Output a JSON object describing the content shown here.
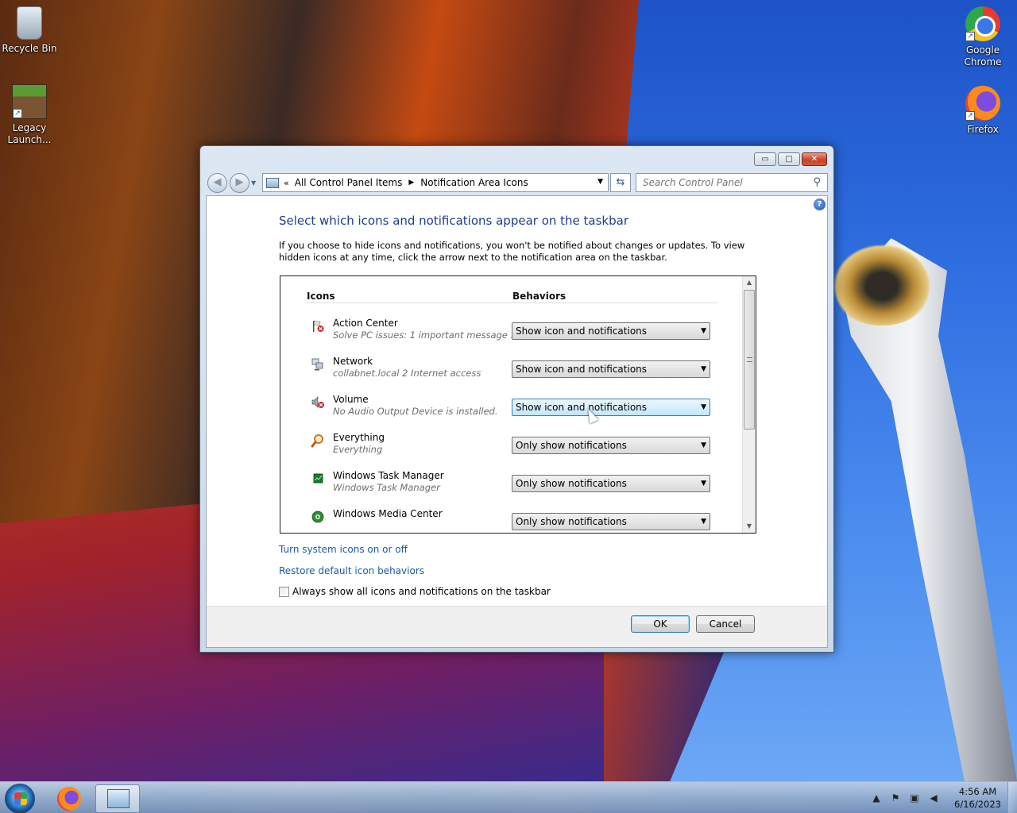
{
  "desktop": {
    "icons": [
      {
        "label": "Recycle Bin"
      },
      {
        "label": "Legacy Launch..."
      },
      {
        "label": "Google Chrome"
      },
      {
        "label": "Firefox"
      }
    ]
  },
  "window": {
    "caption": {
      "minimize": "▭",
      "maximize": "□",
      "close": "✕"
    },
    "nav": {
      "back": "◀",
      "forward": "▶"
    },
    "address": {
      "chevron": "«",
      "crumbs": [
        "All Control Panel Items",
        "Notification Area Icons"
      ]
    },
    "search": {
      "placeholder": "Search Control Panel"
    },
    "help": "?",
    "title": "Select which icons and notifications appear on the taskbar",
    "description": "If you choose to hide icons and notifications, you won't be notified about changes or updates. To view hidden icons at any time, click the arrow next to the notification area on the taskbar.",
    "table": {
      "headers": {
        "icons": "Icons",
        "behaviors": "Behaviors"
      },
      "rows": [
        {
          "name": "Action Center",
          "sub": "Solve PC issues: 1 important message ...",
          "behavior": "Show icon and notifications",
          "icon": "flag-icon"
        },
        {
          "name": "Network",
          "sub": "collabnet.local  2 Internet access",
          "behavior": "Show icon and notifications",
          "icon": "network-icon"
        },
        {
          "name": "Volume",
          "sub": "No Audio Output Device is installed.",
          "behavior": "Show icon and notifications",
          "icon": "speaker-icon"
        },
        {
          "name": "Everything",
          "sub": "Everything",
          "behavior": "Only show notifications",
          "icon": "magnifier-icon"
        },
        {
          "name": "Windows Task Manager",
          "sub": "Windows Task Manager",
          "behavior": "Only show notifications",
          "icon": "task-manager-icon"
        },
        {
          "name": "Windows Media Center",
          "sub": "",
          "behavior": "Only show notifications",
          "icon": "media-center-icon"
        }
      ]
    },
    "links": {
      "system_icons": "Turn system icons on or off",
      "restore": "Restore default icon behaviors"
    },
    "checkbox_label": "Always show all icons and notifications on the taskbar",
    "buttons": {
      "ok": "OK",
      "cancel": "Cancel"
    }
  },
  "taskbar": {
    "clock_time": "4:56 AM",
    "clock_date": "6/16/2023"
  }
}
